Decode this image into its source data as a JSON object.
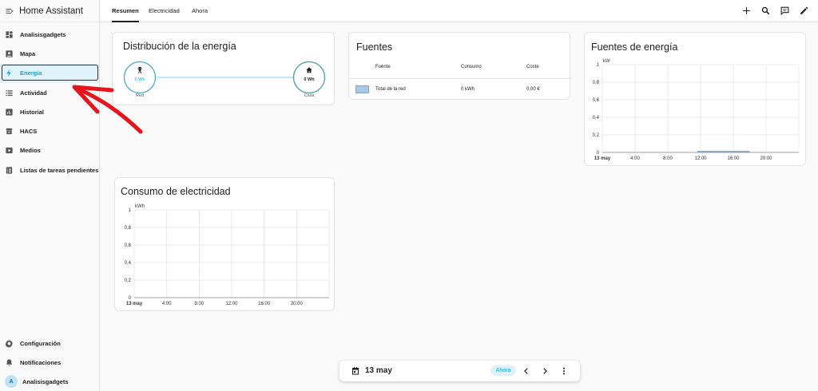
{
  "app": {
    "title": "Home Assistant"
  },
  "sidebar": {
    "items": [
      {
        "label": "Analisisgadgets",
        "icon": "dashboard-icon"
      },
      {
        "label": "Mapa",
        "icon": "map-icon"
      },
      {
        "label": "Energía",
        "icon": "lightning-bolt-icon",
        "active": true
      },
      {
        "label": "Actividad",
        "icon": "list-icon"
      },
      {
        "label": "Historial",
        "icon": "chart-box-icon"
      },
      {
        "label": "HACS",
        "icon": "hacs-icon"
      },
      {
        "label": "Medios",
        "icon": "play-box-icon"
      },
      {
        "label": "Listas de tareas pendientes",
        "icon": "clipboard-list-icon"
      }
    ],
    "bottom": [
      {
        "label": "Configuración",
        "icon": "gear-icon"
      },
      {
        "label": "Notificaciones",
        "icon": "bell-icon"
      }
    ],
    "user": {
      "initial": "A",
      "name": "Analisisgadgets"
    }
  },
  "header": {
    "tabs": [
      "Resumen",
      "Electricidad",
      "Ahora"
    ],
    "active_tab": "Resumen",
    "actions": [
      "plus-icon",
      "search-icon",
      "assist-icon",
      "pencil-icon"
    ]
  },
  "distribution": {
    "title": "Distribución de la energía",
    "grid": {
      "value": "0 Wh",
      "label": "Red"
    },
    "home": {
      "value": "0 Wh",
      "label": "Casa"
    }
  },
  "sources": {
    "title": "Fuentes",
    "headers": [
      "Fuente",
      "Consumo",
      "Coste"
    ],
    "rows": [
      {
        "name": "Total de la red",
        "consumption": "0 kWh",
        "cost": "0,00 €",
        "color": "#a8c9e6"
      }
    ]
  },
  "energy_sources_chart": {
    "title": "Fuentes de energía",
    "unit": "kW",
    "y_ticks": [
      "1",
      "0,8",
      "0,6",
      "0,4",
      "0,2",
      "0"
    ],
    "x_ticks": [
      "13 may",
      "4:00",
      "8:00",
      "12:00",
      "16:00",
      "20:00"
    ]
  },
  "electricity_chart": {
    "title": "Consumo de electricidad",
    "unit": "kWh",
    "y_ticks": [
      "1",
      "0,8",
      "0,6",
      "0,4",
      "0,2",
      "0"
    ],
    "x_ticks": [
      "13 may",
      "4:00",
      "8:00",
      "12:00",
      "16:00",
      "20:00"
    ]
  },
  "datebar": {
    "date": "13 may",
    "now_label": "Ahora"
  },
  "colors": {
    "accent": "#03a9f4",
    "annotation": "#e8141b"
  }
}
